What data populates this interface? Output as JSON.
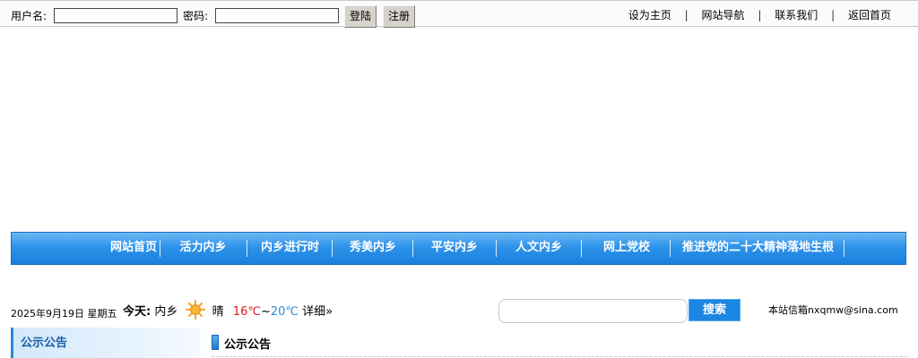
{
  "topbar": {
    "username_label": "用户名:",
    "username_value": "",
    "password_label": "密码:",
    "password_value": "",
    "login_button": "登陆",
    "register_button": "注册",
    "links": [
      "设为主页",
      "网站导航",
      "联系我们",
      "返回首页"
    ],
    "separator": "|"
  },
  "nav": {
    "items": [
      "网站首页",
      "活力内乡",
      "内乡进行时",
      "秀美内乡",
      "平安内乡",
      "人文内乡",
      "网上党校",
      "推进党的二十大精神落地生根"
    ],
    "gradient_top": "#6bb9f5",
    "gradient_bottom": "#1b7fdc"
  },
  "info": {
    "date": "2025年9月19日 星期五",
    "today_label": "今天:",
    "location": "内乡",
    "weather_icon": "sun-icon",
    "condition": "晴",
    "temp_low": "16℃",
    "temp_sep": "~",
    "temp_high": "20℃",
    "detail_link": "详细»",
    "low_color": "#e01b1b",
    "high_color": "#2f8fd8"
  },
  "search": {
    "input_value": "",
    "button_label": "搜索"
  },
  "email_text": "本站信箱nxqmw@sina.com",
  "sidebar": {
    "title": "公示公告"
  },
  "main": {
    "section_title": "公示公告"
  }
}
